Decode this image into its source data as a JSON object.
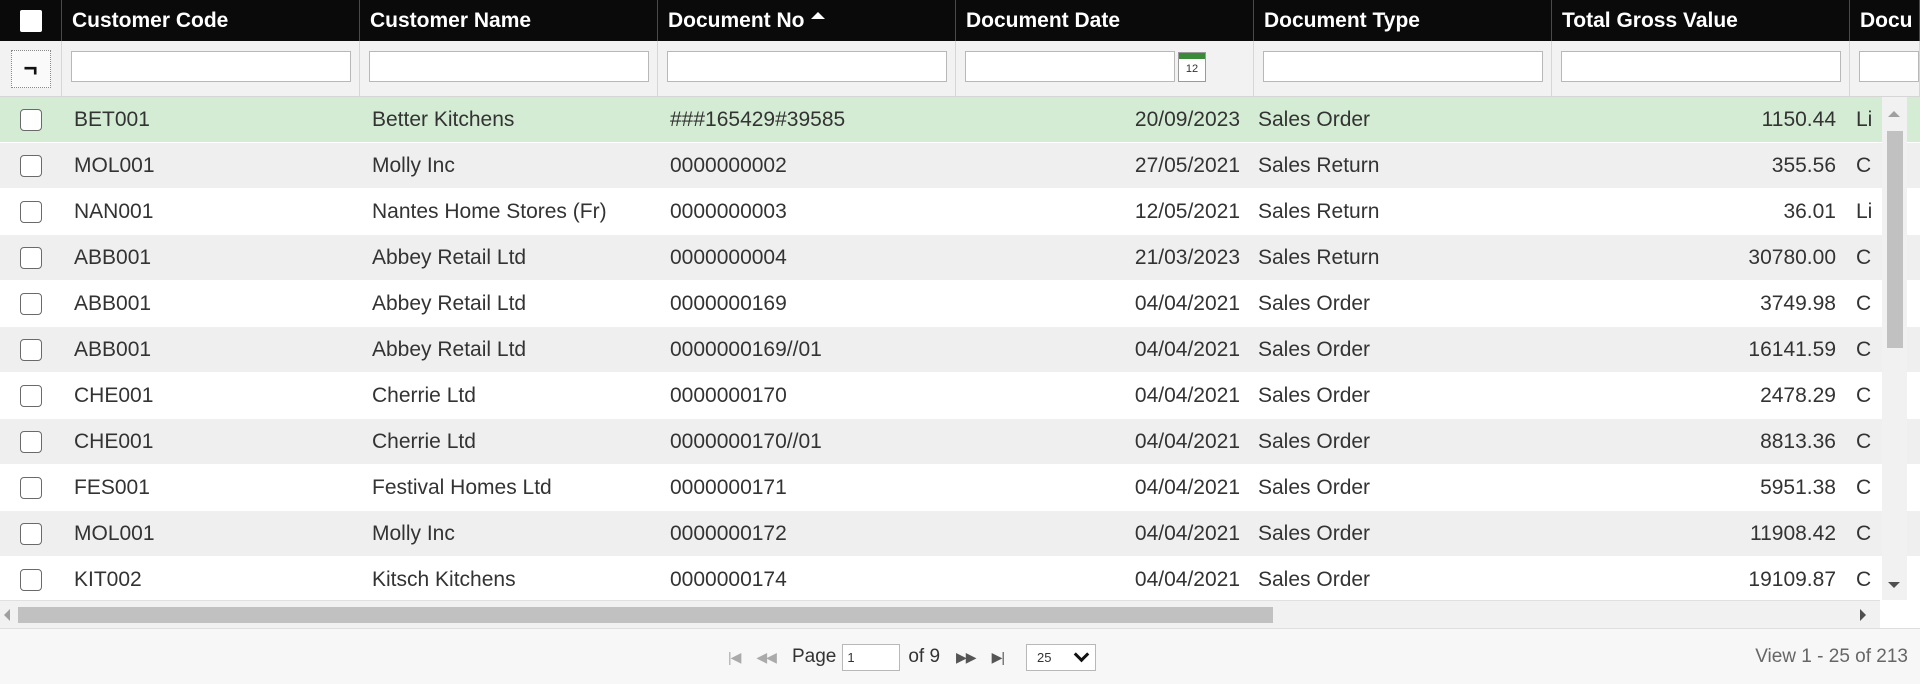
{
  "columns": [
    "Customer Code",
    "Customer Name",
    "Document No",
    "Document Date",
    "Document Type",
    "Total Gross Value",
    "Docu"
  ],
  "sorted_column": "Document No",
  "calendar_label": "12",
  "clear_filter_glyph": "¬",
  "rows": [
    {
      "code": "BET001",
      "name": "Better Kitchens",
      "docno": "###165429#39585",
      "date": "20/09/2023",
      "type": "Sales Order",
      "gross": "1150.44",
      "docu": "Li"
    },
    {
      "code": "MOL001",
      "name": "Molly Inc",
      "docno": "0000000002",
      "date": "27/05/2021",
      "type": "Sales Return",
      "gross": "355.56",
      "docu": "C"
    },
    {
      "code": "NAN001",
      "name": "Nantes Home Stores (Fr)",
      "docno": "0000000003",
      "date": "12/05/2021",
      "type": "Sales Return",
      "gross": "36.01",
      "docu": "Li"
    },
    {
      "code": "ABB001",
      "name": "Abbey Retail Ltd",
      "docno": "0000000004",
      "date": "21/03/2023",
      "type": "Sales Return",
      "gross": "30780.00",
      "docu": "C"
    },
    {
      "code": "ABB001",
      "name": "Abbey Retail Ltd",
      "docno": "0000000169",
      "date": "04/04/2021",
      "type": "Sales Order",
      "gross": "3749.98",
      "docu": "C"
    },
    {
      "code": "ABB001",
      "name": "Abbey Retail Ltd",
      "docno": "0000000169//01",
      "date": "04/04/2021",
      "type": "Sales Order",
      "gross": "16141.59",
      "docu": "C"
    },
    {
      "code": "CHE001",
      "name": "Cherrie Ltd",
      "docno": "0000000170",
      "date": "04/04/2021",
      "type": "Sales Order",
      "gross": "2478.29",
      "docu": "C"
    },
    {
      "code": "CHE001",
      "name": "Cherrie Ltd",
      "docno": "0000000170//01",
      "date": "04/04/2021",
      "type": "Sales Order",
      "gross": "8813.36",
      "docu": "C"
    },
    {
      "code": "FES001",
      "name": "Festival Homes Ltd",
      "docno": "0000000171",
      "date": "04/04/2021",
      "type": "Sales Order",
      "gross": "5951.38",
      "docu": "C"
    },
    {
      "code": "MOL001",
      "name": "Molly Inc",
      "docno": "0000000172",
      "date": "04/04/2021",
      "type": "Sales Order",
      "gross": "11908.42",
      "docu": "C"
    },
    {
      "code": "KIT002",
      "name": "Kitsch Kitchens",
      "docno": "0000000174",
      "date": "04/04/2021",
      "type": "Sales Order",
      "gross": "19109.87",
      "docu": "C"
    }
  ],
  "pager": {
    "page_label": "Page",
    "page_value": "1",
    "of_label": "of 9",
    "page_size": "25",
    "view_info": "View 1 - 25 of 213"
  }
}
